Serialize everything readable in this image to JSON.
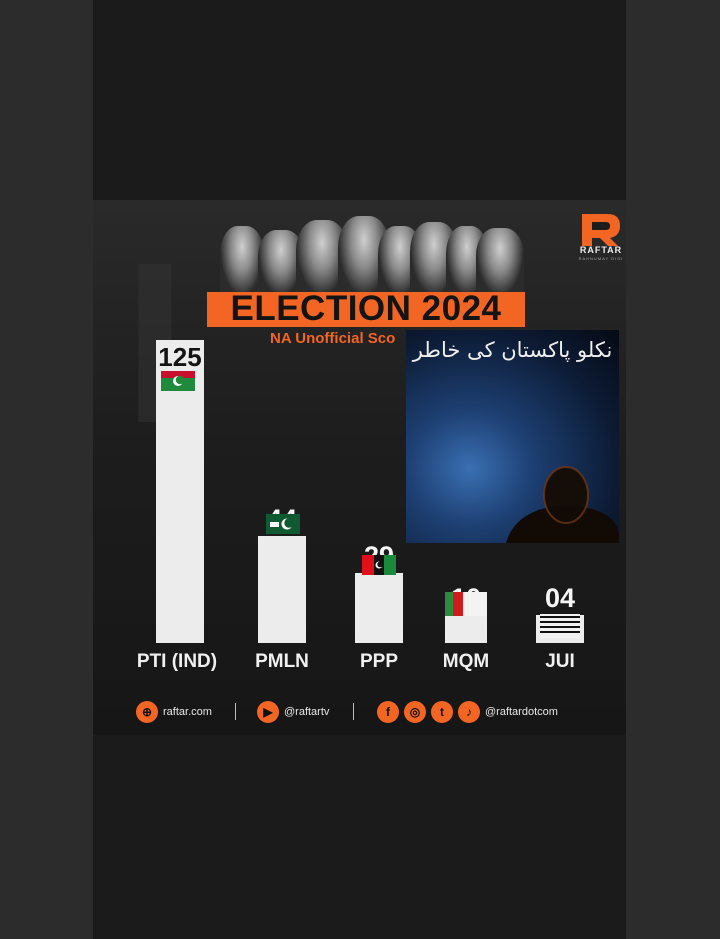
{
  "brand": {
    "name": "RAFTAR",
    "tagline": "RAHNUMAY DIGI"
  },
  "title": "ELECTION 2024",
  "subtitle": "NA Unofficial Sco",
  "inset": {
    "urdu_text": "نکلو پاکستان کی خاطر"
  },
  "chart_data": {
    "type": "bar",
    "title": "ELECTION 2024",
    "categories": [
      "PTI (IND)",
      "PMLN",
      "PPP",
      "MQM",
      "JUI"
    ],
    "values": [
      125,
      44,
      29,
      10,
      4
    ],
    "value_labels": [
      "125",
      "44",
      "29",
      "10",
      "04"
    ],
    "colors": {
      "bar": "#ececec",
      "accent": "#f26522",
      "text": "#f5f5f5"
    }
  },
  "footer": {
    "website": "raftar.com",
    "youtube": "@raftartv",
    "social": "@raftardotcom",
    "icons": [
      "globe-icon",
      "youtube-icon",
      "facebook-icon",
      "instagram-icon",
      "twitter-icon",
      "tiktok-icon"
    ]
  }
}
